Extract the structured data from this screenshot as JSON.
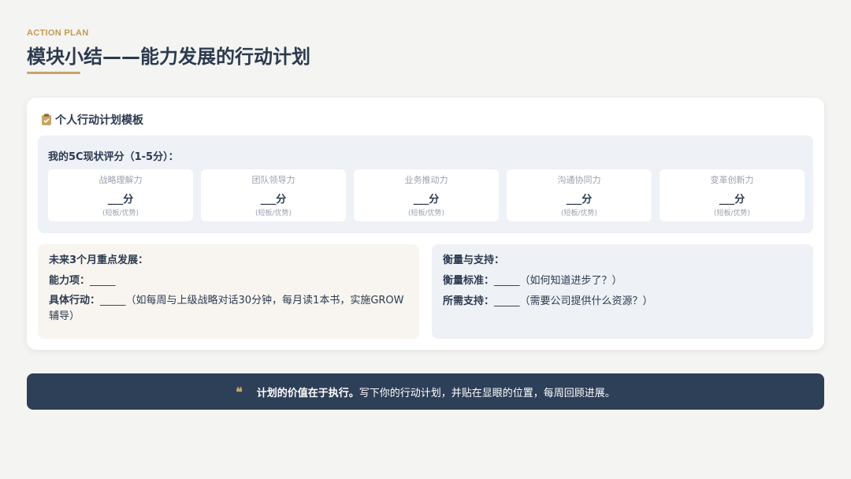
{
  "header": {
    "eyebrow": "ACTION PLAN",
    "title": "模块小结——能力发展的行动计划"
  },
  "card": {
    "title": "个人行动计划模板",
    "score_section": {
      "heading": "我的5C现状评分（1-5分）：",
      "items": [
        {
          "name": "战略理解力",
          "value": "___分",
          "hint": "(短板/优势)"
        },
        {
          "name": "团队领导力",
          "value": "___分",
          "hint": "(短板/优势)"
        },
        {
          "name": "业务推动力",
          "value": "___分",
          "hint": "(短板/优势)"
        },
        {
          "name": "沟通协同力",
          "value": "___分",
          "hint": "(短板/优势)"
        },
        {
          "name": "变革创新力",
          "value": "___分",
          "hint": "(短板/优势)"
        }
      ]
    },
    "development": {
      "heading": "未来3个月重点发展：",
      "ability_label": "能力项：",
      "ability_value": "_____",
      "action_label": "具体行动：",
      "action_value": "_____（如每周与上级战略对话30分钟，每月读1本书，实施GROW辅导）"
    },
    "support": {
      "heading": "衡量与支持：",
      "measure_label": "衡量标准：",
      "measure_value": "_____（如何知道进步了？）",
      "need_label": "所需支持：",
      "need_value": "_____（需要公司提供什么资源？）"
    }
  },
  "quote": {
    "icon": "quote-icon",
    "strong": "计划的价值在于执行。",
    "text": "写下你的行动计划，并贴在显眼的位置，每周回顾进展。"
  },
  "colors": {
    "accent": "#c9a468",
    "navy": "#2e3f58",
    "background": "#f4f4f2"
  }
}
